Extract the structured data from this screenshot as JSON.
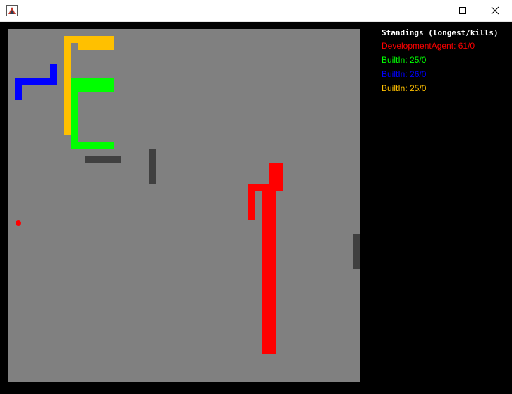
{
  "window": {
    "icon": "java-app-icon",
    "controls": {
      "minimize": "minimize-icon",
      "maximize": "maximize-icon",
      "close": "close-icon"
    }
  },
  "colors": {
    "background": "#000000",
    "board": "#808080",
    "obstacle": "#404040",
    "apple": "#ff0000",
    "red_snake": "#ff0000",
    "yellow_snake": "#ffc000",
    "green_snake": "#00ff00",
    "blue_snake": "#0000ff"
  },
  "standings": {
    "title": "Standings (longest/kills)",
    "rows": [
      {
        "label": "DevelopmentAgent: 61/0",
        "color": "#ff0000"
      },
      {
        "label": "BuiltIn: 25/0",
        "color": "#00ff00"
      },
      {
        "label": "BuiltIn: 26/0",
        "color": "#0000ff"
      },
      {
        "label": "BuiltIn: 25/0",
        "color": "#ffc000"
      }
    ]
  }
}
